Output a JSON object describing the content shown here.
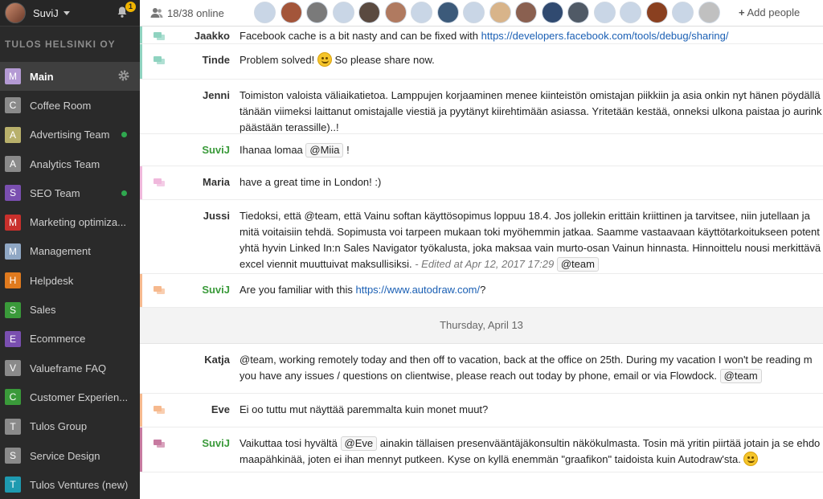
{
  "user": {
    "name": "SuviJ",
    "notifications": "1"
  },
  "org": "TULOS HELSINKI OY",
  "flows": [
    {
      "letter": "M",
      "label": "Main",
      "color": "#b49ad4",
      "active": true,
      "dot": false
    },
    {
      "letter": "C",
      "label": "Coffee Room",
      "color": "#8a8a8a",
      "dot": false
    },
    {
      "letter": "A",
      "label": "Advertising Team",
      "color": "#b8b06b",
      "dot": true
    },
    {
      "letter": "A",
      "label": "Analytics Team",
      "color": "#8a8a8a",
      "dot": false
    },
    {
      "letter": "S",
      "label": "SEO Team",
      "color": "#7a4fb0",
      "dot": true
    },
    {
      "letter": "M",
      "label": "Marketing optimiza...",
      "color": "#c9302c",
      "dot": false
    },
    {
      "letter": "M",
      "label": "Management",
      "color": "#8fa7c4",
      "dot": false
    },
    {
      "letter": "H",
      "label": "Helpdesk",
      "color": "#e07a1e",
      "dot": false
    },
    {
      "letter": "S",
      "label": "Sales",
      "color": "#3a9a3a",
      "dot": false
    },
    {
      "letter": "E",
      "label": "Ecommerce",
      "color": "#7a4fb0",
      "dot": false
    },
    {
      "letter": "V",
      "label": "Valueframe FAQ",
      "color": "#8a8a8a",
      "dot": false
    },
    {
      "letter": "C",
      "label": "Customer Experien...",
      "color": "#3a9a3a",
      "dot": false
    },
    {
      "letter": "T",
      "label": "Tulos Group",
      "color": "#8a8a8a",
      "dot": false
    },
    {
      "letter": "S",
      "label": "Service Design",
      "color": "#8a8a8a",
      "dot": false
    },
    {
      "letter": "T",
      "label": "Tulos Ventures (new)",
      "color": "#1e9ab0",
      "dot": false
    }
  ],
  "topbar": {
    "online": "18/38 online",
    "add_people": "Add people"
  },
  "avatar_colors": [
    "#c9d6e6",
    "#a3553a",
    "#7a7a7a",
    "#c9d6e6",
    "#5a4a40",
    "#b07a60",
    "#c9d6e6",
    "#3c5a7a",
    "#c9d6e6",
    "#d8b48a",
    "#8a6050",
    "#304a70",
    "#505a66",
    "#c9d6e6",
    "#c9d6e6",
    "#8a4020",
    "#c9d6e6",
    "#c0c0c0"
  ],
  "messages": [
    {
      "author": "Jaakko",
      "self": false,
      "bar": "#8fd3c0",
      "bubble": "#8fd3c0",
      "lines": [
        "Facebook cache is a bit nasty and can be fixed with "
      ],
      "link": "https://developers.facebook.com/tools/debug/sharing/"
    },
    {
      "author": "Tinde",
      "self": false,
      "bar": "#8fd3c0",
      "bubble": "#8fd3c0",
      "text1": "Problem solved!",
      "text2": "So please share now."
    },
    {
      "author": "Jenni",
      "self": false,
      "bar": "",
      "bubble": "",
      "lines": [
        "Toimiston valoista väliaikatietoa. Lamppujen korjaaminen menee kiinteistön omistajan piikkiin ja asia onkin nyt hänen pöydällä",
        "tänään viimeksi laittanut omistajalle viestiä ja pyytänyt kiirehtimään asiassa. Yritetään kestää, onneksi ulkona paistaa jo aurink",
        "päästään terassille)..!"
      ]
    },
    {
      "author": "SuviJ",
      "self": true,
      "bar": "",
      "bubble": "",
      "pre": "Ihanaa lomaa",
      "tag": "@Miia",
      "post": "!"
    },
    {
      "author": "Maria",
      "self": false,
      "bar": "#f0b8dc",
      "bubble": "#f0b8dc",
      "lines": [
        "have a great time in London! :)"
      ]
    },
    {
      "author": "Jussi",
      "self": false,
      "bar": "",
      "bubble": "",
      "lines": [
        "Tiedoksi, että @team, että Vainu softan käyttösopimus loppuu 18.4. Jos jollekin erittäin kriittinen ja tarvitsee, niin jutellaan ja",
        "mitä voitaisiin tehdä. Sopimusta voi tarpeen mukaan toki myöhemmin jatkaa. Saamme vastaavaan käyttötarkoitukseen potent",
        "yhtä hyvin Linked In:n Sales Navigator työkalusta, joka maksaa vain murto-osan Vainun hinnasta. Hinnoittelu nousi merkittävä",
        "excel viennit muuttuivat maksullisiksi."
      ],
      "edited": "- Edited at Apr 12, 2017 17:29",
      "tag": "@team"
    },
    {
      "author": "SuviJ",
      "self": true,
      "bar": "#f6b98e",
      "bubble": "#f6b98e",
      "pre": "Are you familiar with this ",
      "link": "https://www.autodraw.com/",
      "post": "?"
    },
    {
      "author": "Katja",
      "self": false,
      "bar": "",
      "bubble": "",
      "lines": [
        "@team, working remotely today and then off to vacation, back at the office on 25th. During my vacation I won't be reading m",
        "you have any issues / questions on clientwise, please reach out today by phone, email or via Flowdock."
      ],
      "tag": "@team"
    },
    {
      "author": "Eve",
      "self": false,
      "bar": "#f6b98e",
      "bubble": "#f6b98e",
      "lines": [
        "Ei oo tuttu mut näyttää paremmalta kuin monet muut?"
      ]
    },
    {
      "author": "SuviJ",
      "self": true,
      "bar": "#c77aa0",
      "bubble": "#c77aa0",
      "pre": "Vaikuttaa tosi hyvältä",
      "tag": "@Eve",
      "post": "ainakin tällaisen presenvääntäjäkonsultin näkökulmasta. Tosin mä yritin piirtää jotain ja se ehdo",
      "line2": "maapähkinää, joten ei ihan mennyt putkeen. Kyse on kyllä enemmän \"graafikon\" taidoista kuin Autodraw'sta."
    }
  ],
  "day_divider": "Thursday, April 13"
}
